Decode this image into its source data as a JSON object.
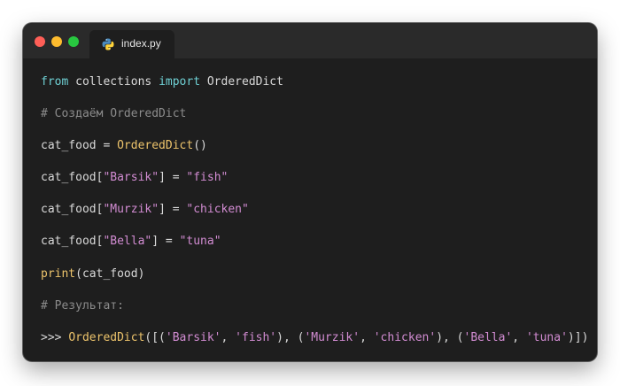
{
  "tab": {
    "filename": "index.py",
    "icon": "python-icon"
  },
  "window_controls": {
    "close": "#ff5f57",
    "minimize": "#febc2e",
    "zoom": "#28c840"
  },
  "code": {
    "l1": {
      "kw1": "from",
      "mod": " collections ",
      "kw2": "import",
      "name": " OrderedDict"
    },
    "l2": {
      "comment": "# Создаём OrderedDict"
    },
    "l3": {
      "var": "cat_food = ",
      "fn": "OrderedDict",
      "rest": "()"
    },
    "l4": {
      "pre": "cat_food[",
      "key": "\"Barsik\"",
      "mid": "] = ",
      "val": "\"fish\""
    },
    "l5": {
      "pre": "cat_food[",
      "key": "\"Murzik\"",
      "mid": "] = ",
      "val": "\"chicken\""
    },
    "l6": {
      "pre": "cat_food[",
      "key": "\"Bella\"",
      "mid": "] = ",
      "val": "\"tuna\""
    },
    "l7": {
      "fn": "print",
      "rest": "(cat_food)"
    },
    "l8": {
      "comment": "# Результат:"
    },
    "l9": {
      "prompt": ">>> ",
      "fn": "OrderedDict",
      "p1": "([(",
      "s1": "'Barsik'",
      "c1": ", ",
      "s2": "'fish'",
      "p2": "), (",
      "s3": "'Murzik'",
      "c2": ", ",
      "s4": "'chicken'",
      "p3": "), (",
      "s5": "'Bella'",
      "c3": ", ",
      "s6": "'tuna'",
      "p4": ")])"
    }
  },
  "colors": {
    "keyword": "#6fd0d4",
    "function": "#ecc36b",
    "string": "#d28cd2",
    "comment": "#8b8b8b",
    "background": "#1e1e1e"
  }
}
